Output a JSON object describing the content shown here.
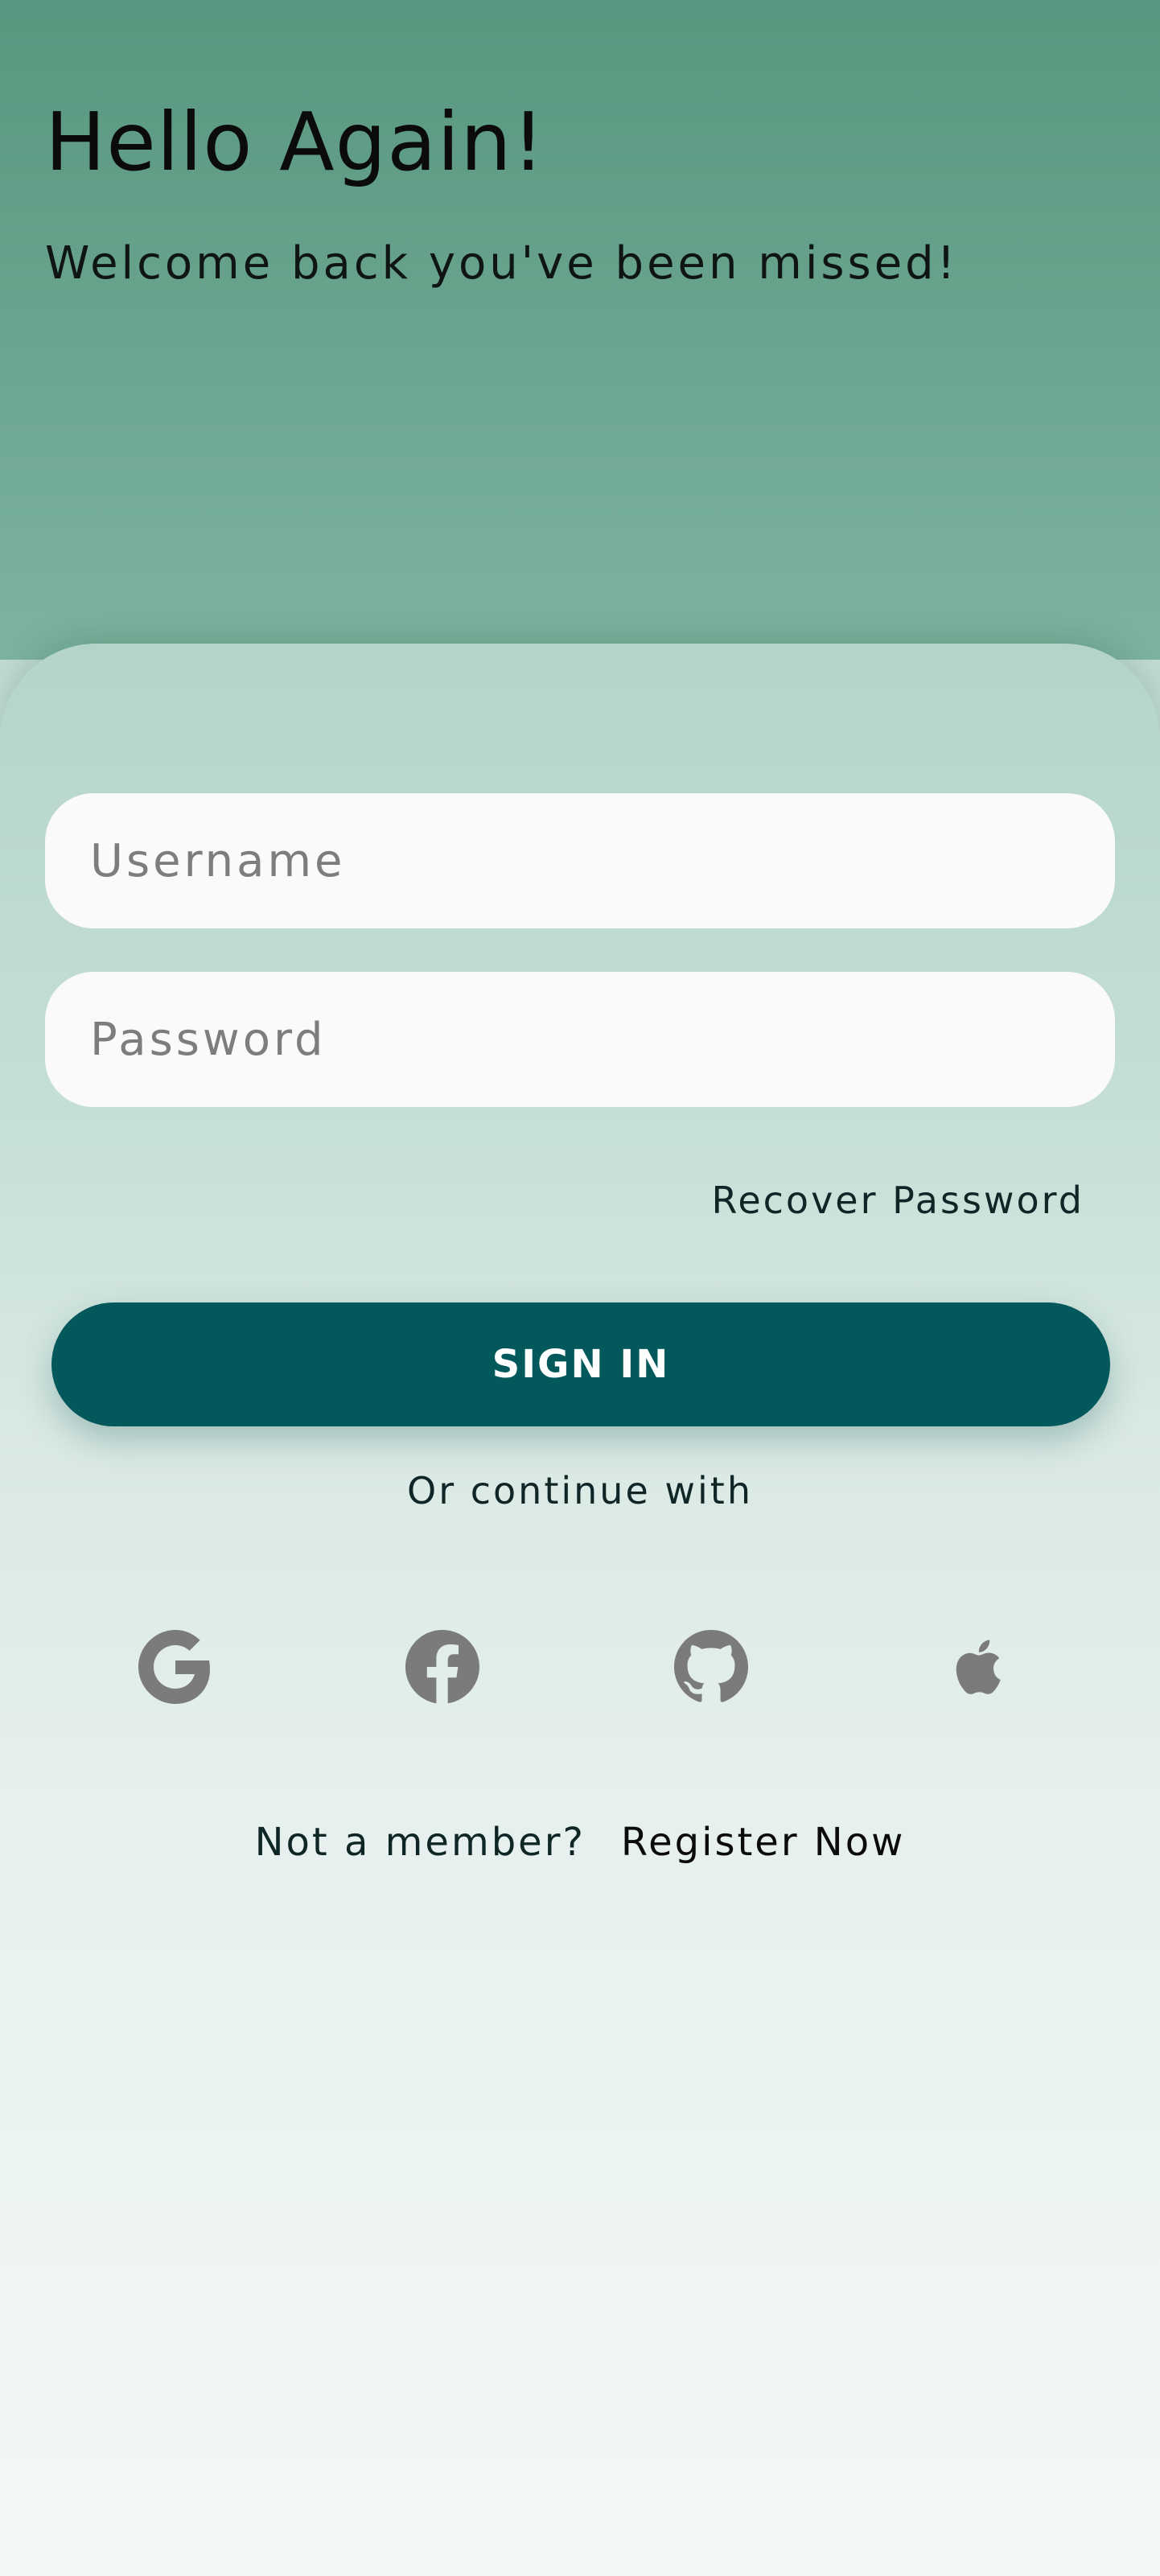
{
  "header": {
    "title": "Hello Again!",
    "subtitle": "Welcome back you've been missed!"
  },
  "form": {
    "username_placeholder": "Username",
    "password_placeholder": "Password",
    "recover_label": "Recover Password",
    "signin_label": "SIGN IN"
  },
  "social": {
    "divider_text": "Or continue with",
    "providers": [
      {
        "name": "google-icon"
      },
      {
        "name": "facebook-icon"
      },
      {
        "name": "github-icon"
      },
      {
        "name": "apple-icon"
      }
    ],
    "icon_color": "#7b7b7b"
  },
  "footer": {
    "prompt": "Not a member?",
    "register_label": "Register Now"
  },
  "colors": {
    "primary": "#02585a",
    "header_bg": "#58977f",
    "input_bg": "#fafafa"
  }
}
